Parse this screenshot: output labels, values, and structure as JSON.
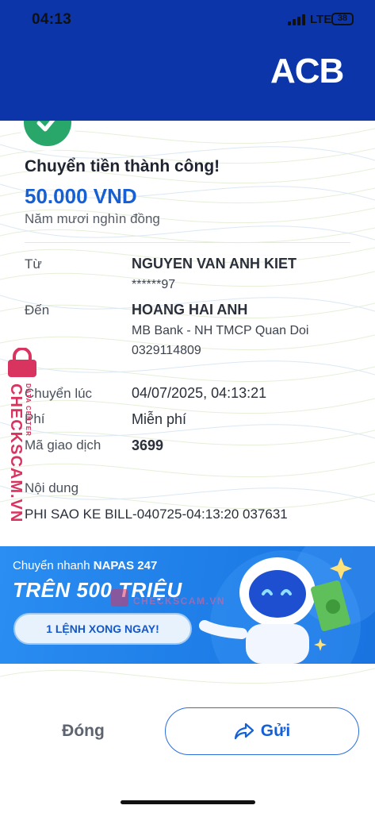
{
  "status_bar": {
    "time": "04:13",
    "network": "LTE",
    "battery": "38"
  },
  "header": {
    "logo": "ACB",
    "brand_color": "#0b35a8"
  },
  "receipt": {
    "title": "Chuyển tiền thành công!",
    "amount": "50.000 VND",
    "amount_words": "Năm mươi nghìn đồng",
    "from": {
      "label": "Từ",
      "name": "NGUYEN VAN ANH KIET",
      "account": "******97"
    },
    "to": {
      "label": "Đến",
      "name": "HOANG HAI ANH",
      "bank": "MB Bank - NH TMCP Quan Doi",
      "account": "0329114809"
    },
    "time": {
      "label": "Chuyển lúc",
      "value": "04/07/2025, 04:13:21"
    },
    "fee": {
      "label": "Phí",
      "value": "Miễn phí"
    },
    "transaction_id": {
      "label": "Mã giao dịch",
      "value": "3699"
    },
    "content": {
      "label": "Nội dung",
      "value": "PHI SAO KE BILL-040725-04:13:20 037631"
    },
    "accent_color": "#1560d6",
    "success_color": "#29a76a"
  },
  "watermark": {
    "text": "CHECKSCAM.VN",
    "sub": "DATA CENTER",
    "color": "#d8345f"
  },
  "banner": {
    "line1_prefix": "Chuyển nhanh ",
    "line1_bold": "NAPAS 247",
    "headline": "TRÊN 500 TRIỆU",
    "button": "1 LỆNH XONG NGAY!",
    "watermark": "CHECKSCAM.VN"
  },
  "actions": {
    "close": "Đóng",
    "send": "Gửi"
  },
  "icons": [
    "check-icon",
    "share-icon",
    "lock-icon",
    "signal-icon",
    "battery-icon"
  ]
}
